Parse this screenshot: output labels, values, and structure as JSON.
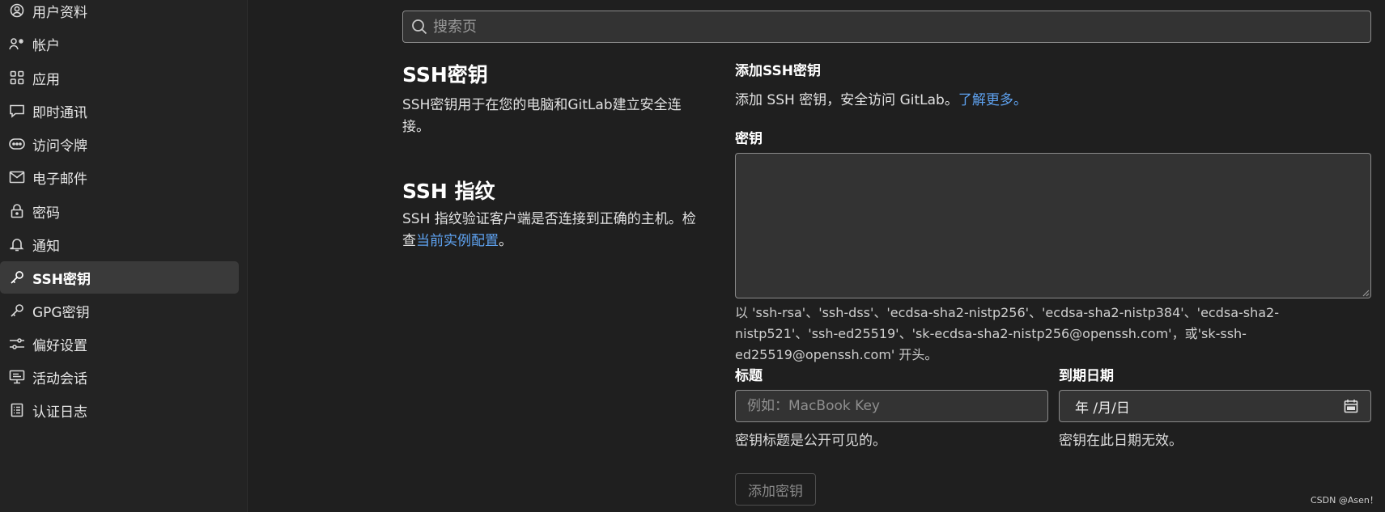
{
  "sidebar": {
    "items": [
      {
        "label": "用户资料",
        "icon": "user-circle-icon",
        "active": false
      },
      {
        "label": "帐户",
        "icon": "account-icon",
        "active": false
      },
      {
        "label": "应用",
        "icon": "applications-icon",
        "active": false
      },
      {
        "label": "即时通讯",
        "icon": "chat-icon",
        "active": false
      },
      {
        "label": "访问令牌",
        "icon": "token-icon",
        "active": false
      },
      {
        "label": "电子邮件",
        "icon": "mail-icon",
        "active": false
      },
      {
        "label": "密码",
        "icon": "lock-icon",
        "active": false
      },
      {
        "label": "通知",
        "icon": "bell-icon",
        "active": false
      },
      {
        "label": "SSH密钥",
        "icon": "key-icon",
        "active": true
      },
      {
        "label": "GPG密钥",
        "icon": "key-icon",
        "active": false
      },
      {
        "label": "偏好设置",
        "icon": "preferences-icon",
        "active": false
      },
      {
        "label": "活动会话",
        "icon": "monitor-icon",
        "active": false
      },
      {
        "label": "认证日志",
        "icon": "log-icon",
        "active": false
      }
    ]
  },
  "search": {
    "placeholder": "搜索页"
  },
  "ssh_keys_section": {
    "title": "SSH密钥",
    "description": "SSH密钥用于在您的电脑和GitLab建立安全连接。"
  },
  "ssh_fingerprint_section": {
    "title": "SSH 指纹",
    "description_prefix": "SSH 指纹验证客户端是否连接到正确的主机。检查",
    "link": "当前实例配置",
    "description_suffix": "。"
  },
  "add_key": {
    "heading": "添加SSH密钥",
    "intro": "添加 SSH 密钥，安全访问 GitLab。",
    "learn_more": "了解更多。",
    "key_label": "密钥",
    "key_value": "",
    "key_hint": "以 'ssh-rsa'、'ssh-dss'、'ecdsa-sha2-nistp256'、'ecdsa-sha2-nistp384'、'ecdsa-sha2-nistp521'、'ssh-ed25519'、'sk-ecdsa-sha2-nistp256@openssh.com'，或'sk-ssh-ed25519@openssh.com' 开头。",
    "title_label": "标题",
    "title_placeholder": "例如：MacBook Key",
    "title_help": "密钥标题是公开可见的。",
    "expiry_label": "到期日期",
    "expiry_value": "年 /月/日",
    "expiry_help": "密钥在此日期无效。",
    "submit_label": "添加密钥"
  },
  "watermark": "CSDN @Asen！",
  "colors": {
    "accent_link": "#5ea2f0",
    "background": "#1f1f1f",
    "sidebar_active": "#3a3a3a"
  }
}
